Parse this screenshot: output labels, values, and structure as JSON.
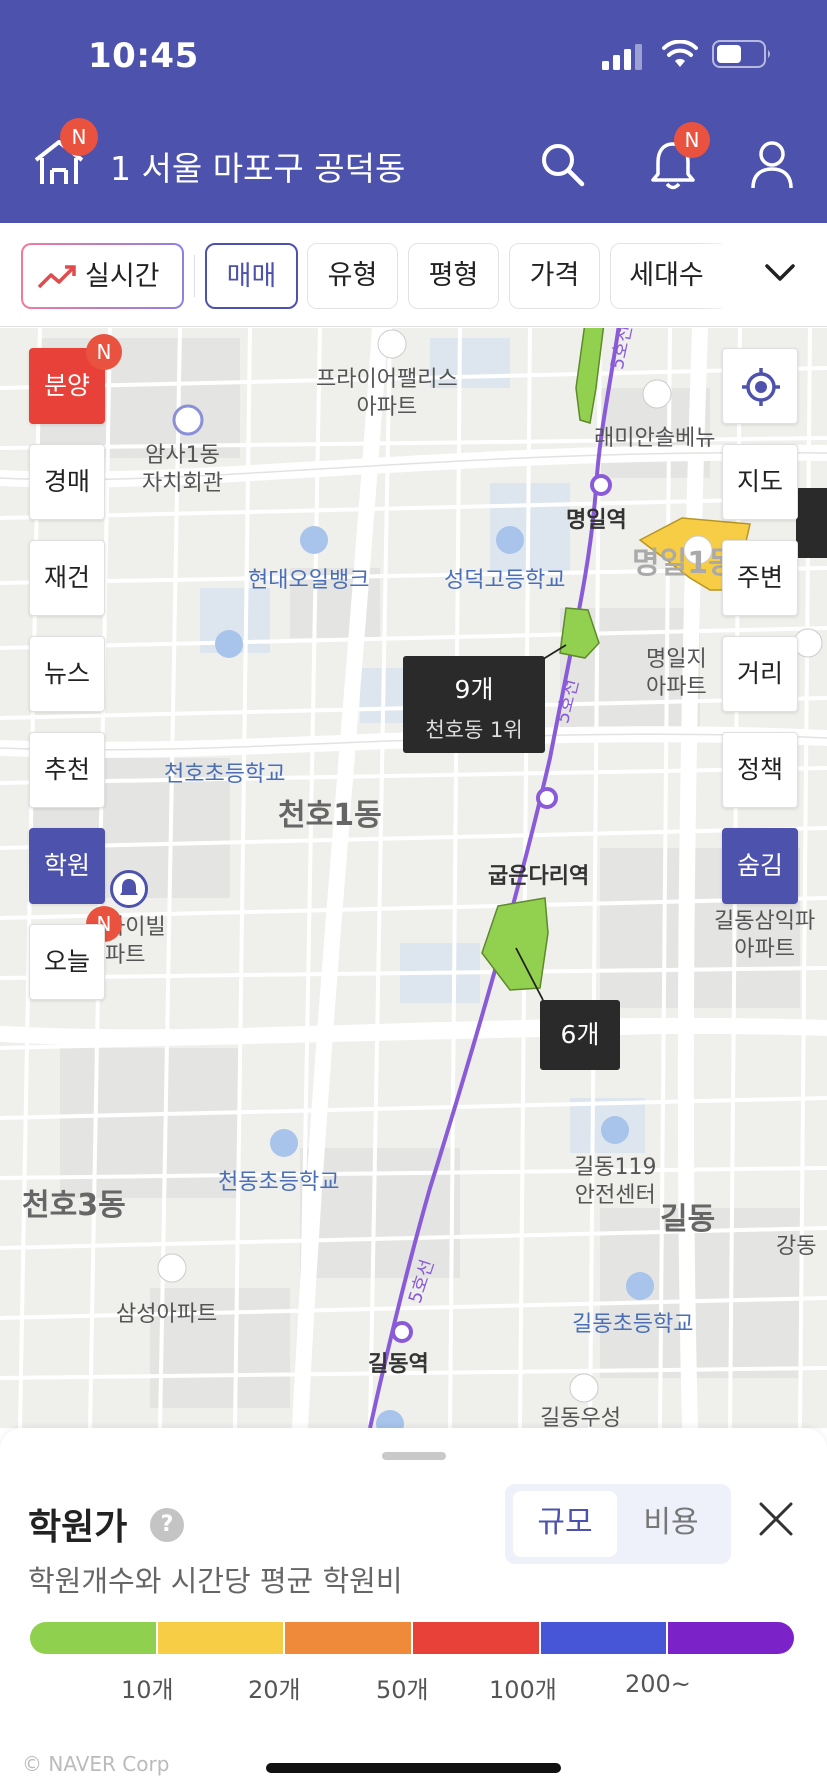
{
  "status_bar": {
    "time": "10:45"
  },
  "header": {
    "address": "1  서울 마포구 공덕동",
    "home_badge": "N",
    "bell_badge": "N"
  },
  "filters": {
    "realtime": "실시간",
    "chips": [
      "매매",
      "유형",
      "평형",
      "가격",
      "세대수"
    ]
  },
  "map": {
    "places": {
      "prime_palace": "프라이어팰리스\n아파트",
      "cheonho1_center": "암사1동\n자치회관",
      "amsa1": "암사1동",
      "hyundai_bank": "현대오일뱅크",
      "seongdeok_school": "성덕고등학교",
      "myeongil_station": "명일역",
      "myeongil1": "명일1동",
      "cheonho_elem": "천호초등학교",
      "cheonho1dong": "천호1동",
      "gubeun_station": "굽은다리역",
      "cheondong_elem": "천동초등학교",
      "gildong119": "길동119\n안전센터",
      "cheonho3dong": "천호3동",
      "gildong": "길동",
      "samsung_apt": "삼성아파트",
      "gildong_station": "길동역",
      "gildong_elem": "길동초등학교",
      "gildong_woosung": "길동우성",
      "line5_label": "5호선",
      "gangdong": "강동",
      "gildong_samik": "길동삼익파\n아파트",
      "raemian": "래미안솔베뉴",
      "myeongil_apt": "명일지\n아파트",
      "hailbil": "하이빌\n파트"
    },
    "info_boxes": [
      {
        "count": "9개",
        "sub": "천호동 1위"
      },
      {
        "count": "6개",
        "sub": ""
      }
    ],
    "left_buttons": [
      {
        "label": "분양",
        "badge": "N"
      },
      {
        "label": "경매"
      },
      {
        "label": "재건"
      },
      {
        "label": "뉴스"
      },
      {
        "label": "추천"
      },
      {
        "label": "학원",
        "badge": "N"
      },
      {
        "label": "오늘"
      }
    ],
    "right_buttons": [
      "지도",
      "주변",
      "거리",
      "정책",
      "숨김"
    ]
  },
  "sheet": {
    "title": "학원가",
    "help": "?",
    "description": "학원개수와 시간당 평균 학원비",
    "toggle": {
      "scale": "규모",
      "cost": "비용",
      "selected": "규모"
    },
    "legend": {
      "colors": [
        "#8fd14f",
        "#f7cd45",
        "#f08a3b",
        "#e8413a",
        "#4656d6",
        "#7b23c9"
      ],
      "ticks": [
        "10개",
        "20개",
        "50개",
        "100개",
        "200~"
      ]
    },
    "copyright": "© NAVER Corp"
  },
  "colors": {
    "brand": "#4d52ad",
    "accent_red": "#e8523e",
    "selected": "#4d52ad"
  }
}
